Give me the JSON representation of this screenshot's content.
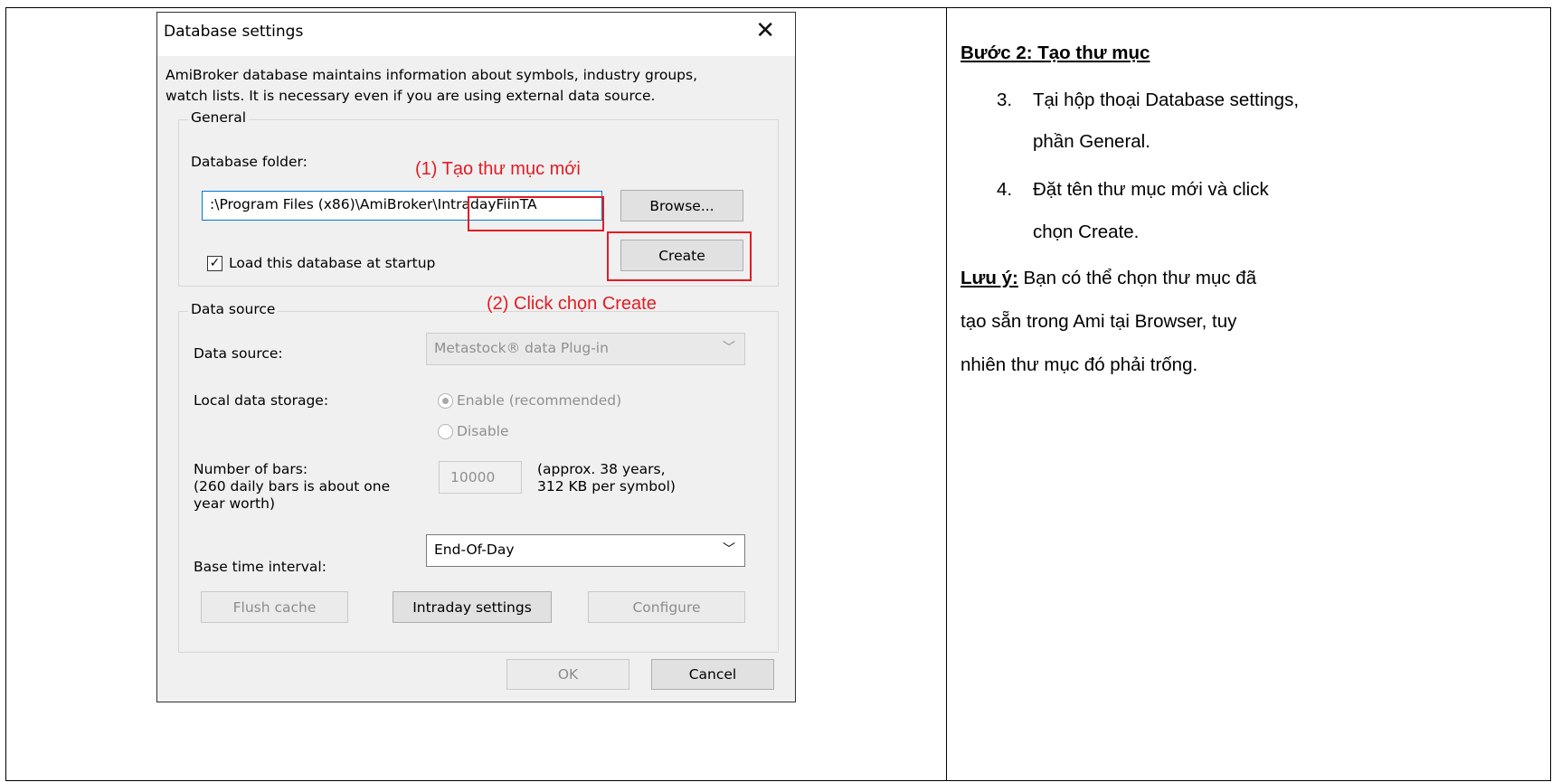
{
  "dialog": {
    "title": "Database settings",
    "close_glyph": "✕",
    "description_line1": "AmiBroker database maintains information about symbols, industry groups,",
    "description_line2": "watch lists. It is necessary even if you are using external data source.",
    "general": {
      "group_label": "General",
      "folder_label": "Database folder:",
      "folder_value": ":\\Program Files (x86)\\AmiBroker\\IntradayFiinTA",
      "browse_label": "Browse...",
      "create_label": "Create",
      "load_checkbox_label": "Load this database at startup",
      "load_checked": true
    },
    "data_source": {
      "group_label": "Data source",
      "source_label": "Data source:",
      "source_value": "Metastock® data Plug-in",
      "storage_label": "Local data storage:",
      "enable_label": "Enable (recommended)",
      "disable_label": "Disable",
      "bars_label_1": "Number of bars:",
      "bars_label_2": "(260 daily bars is about one",
      "bars_label_3": "year worth)",
      "bars_value": "10000",
      "bars_note_1": "(approx. 38 years,",
      "bars_note_2": "312 KB per symbol)",
      "interval_label": "Base time interval:",
      "interval_value": "End-Of-Day",
      "flush_label": "Flush cache",
      "intraday_label": "Intraday settings",
      "configure_label": "Configure"
    },
    "ok_label": "OK",
    "cancel_label": "Cancel"
  },
  "annotations": {
    "step1": "(1) Tạo thư mục mới",
    "step2": "(2) Click chọn Create",
    "color": "#e31b23"
  },
  "instructions": {
    "heading": "Bước 2: Tạo thư mục",
    "item3_num": "3.",
    "item3_line1": "Tại hộp thoại Database settings,",
    "item3_line2": "phần General.",
    "item4_num": "4.",
    "item4_line1": "Đặt tên thư mục mới và click",
    "item4_line2": "chọn Create.",
    "note_label": "Lưu ý:",
    "note_line1": " Bạn có thể chọn thư mục đã",
    "note_line2": "tạo sẵn trong Ami tại Browser, tuy",
    "note_line3": "nhiên thư mục đó phải trống."
  }
}
